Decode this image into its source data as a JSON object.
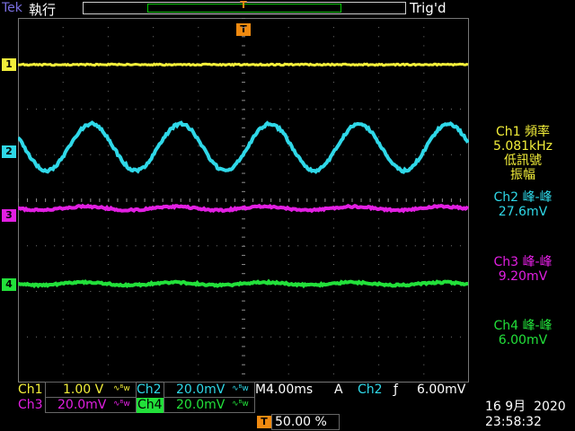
{
  "header": {
    "brand": "Tek",
    "mode": "執行",
    "trigger_status": "Trig'd"
  },
  "trigger_marker": "T",
  "channel_markers": [
    "1",
    "2",
    "3",
    "4"
  ],
  "measurements": {
    "ch1": {
      "title": "Ch1 頻率",
      "value": "5.081kHz",
      "note1": "低訊號",
      "note2": "振幅"
    },
    "ch2": {
      "title": "Ch2 峰-峰",
      "value": "27.6mV"
    },
    "ch3": {
      "title": "Ch3 峰-峰",
      "value": "9.20mV"
    },
    "ch4": {
      "title": "Ch4 峰-峰",
      "value": "6.00mV"
    }
  },
  "bottom": {
    "ch1_label": "Ch1",
    "ch1_scale": "1.00 V",
    "ch2_label": "Ch2",
    "ch2_scale": "20.0mV",
    "ch3_label": "Ch3",
    "ch3_scale": "20.0mV",
    "ch4_label": "Ch4",
    "ch4_scale": "20.0mV",
    "bw_symbol": "∿ᴮw",
    "timebase": "M4.00ms",
    "trig_mode": "A",
    "trig_source": "Ch2",
    "trig_slope": "ƒ",
    "trig_level": "6.00mV",
    "trig_pos_icon": "T",
    "trig_pos": "50.00 %",
    "date": "16 9月  2020",
    "time": "23:58:32"
  },
  "colors": {
    "ch1": "#f2ee3a",
    "ch2": "#2fd8e8",
    "ch3": "#e21fe2",
    "ch4": "#22e03a",
    "trigger": "#f08a10"
  }
}
